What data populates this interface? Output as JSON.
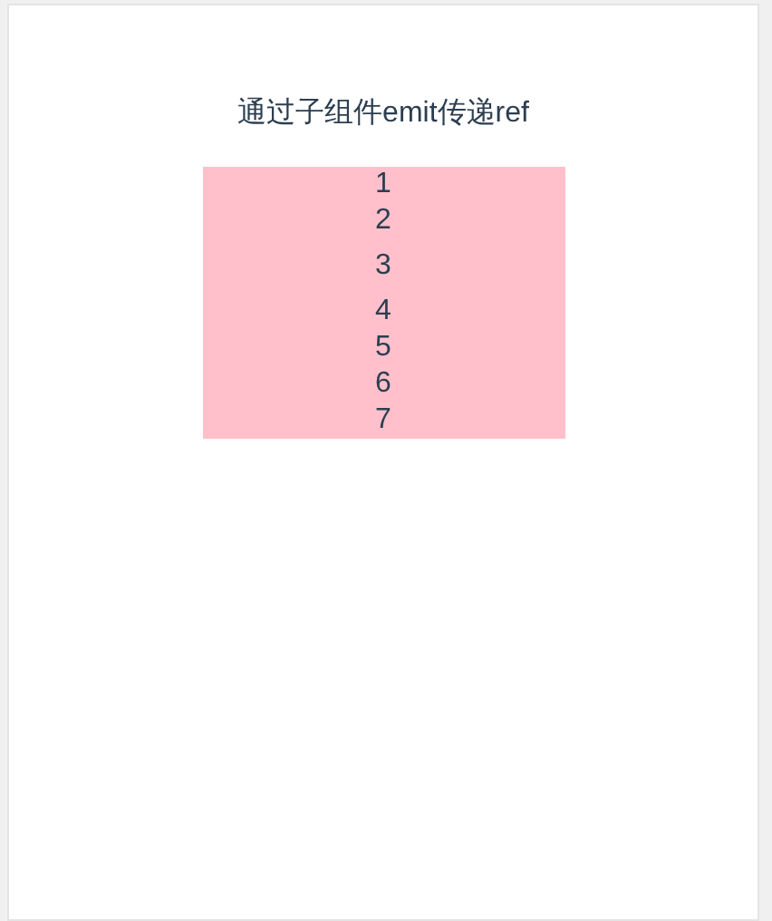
{
  "title": "通过子组件emit传递ref",
  "items": [
    {
      "kind": "plain",
      "text": "1"
    },
    {
      "kind": "plain",
      "text": "2"
    },
    {
      "kind": "component",
      "text": "3"
    },
    {
      "kind": "plain",
      "text": "4"
    },
    {
      "kind": "plain",
      "text": "5"
    },
    {
      "kind": "plain",
      "text": "6"
    },
    {
      "kind": "plain",
      "text": "7"
    }
  ]
}
